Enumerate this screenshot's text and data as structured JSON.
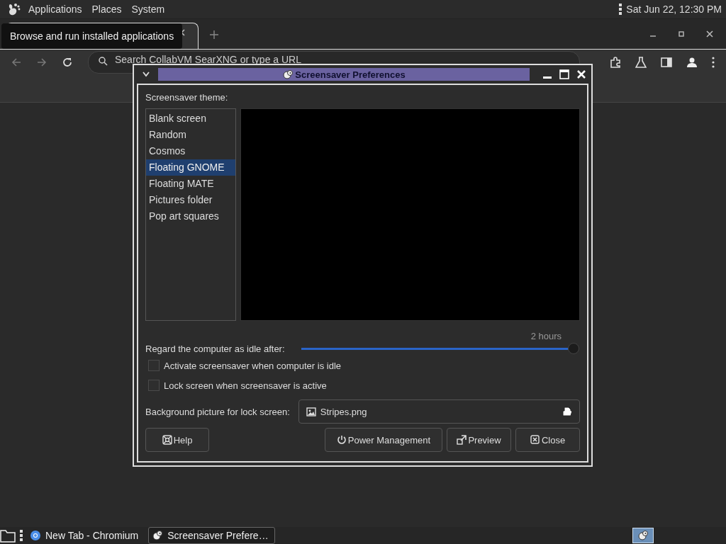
{
  "top_panel": {
    "menus": [
      "Applications",
      "Places",
      "System"
    ],
    "clock": "Sat Jun 22, 12:30 PM"
  },
  "tooltip": "Browse and run installed applications",
  "browser": {
    "address_placeholder": "Search CollabVM SearXNG or type a URL"
  },
  "dialog": {
    "title": "Screensaver Preferences",
    "theme_label": "Screensaver theme:",
    "themes": [
      {
        "label": "Blank screen",
        "selected": false
      },
      {
        "label": "Random",
        "selected": false
      },
      {
        "label": "Cosmos",
        "selected": false
      },
      {
        "label": "Floating GNOME",
        "selected": true
      },
      {
        "label": "Floating MATE",
        "selected": false
      },
      {
        "label": "Pictures folder",
        "selected": false
      },
      {
        "label": "Pop art squares",
        "selected": false
      }
    ],
    "idle_label": "Regard the computer as idle after:",
    "idle_value": "2 hours",
    "idle_slider": {
      "level": 1
    },
    "checkboxes": [
      {
        "label": "Activate screensaver when computer is idle",
        "checked": false
      },
      {
        "label": "Lock screen when screensaver is active",
        "checked": false
      }
    ],
    "lock_bg_label": "Background picture for lock screen:",
    "lock_bg_file": "Stripes.png",
    "buttons": [
      {
        "label": "Help",
        "kind": "help"
      },
      {
        "label": "Power Management",
        "kind": "power"
      },
      {
        "label": "Preview",
        "kind": "preview"
      },
      {
        "label": "Close",
        "kind": "close"
      }
    ]
  },
  "taskbar": {
    "items": [
      {
        "label": "New Tab - Chromium",
        "kind": "browser",
        "selected": false
      },
      {
        "label": "Screensaver Prefere…",
        "kind": "screensaver",
        "selected": true
      }
    ]
  }
}
